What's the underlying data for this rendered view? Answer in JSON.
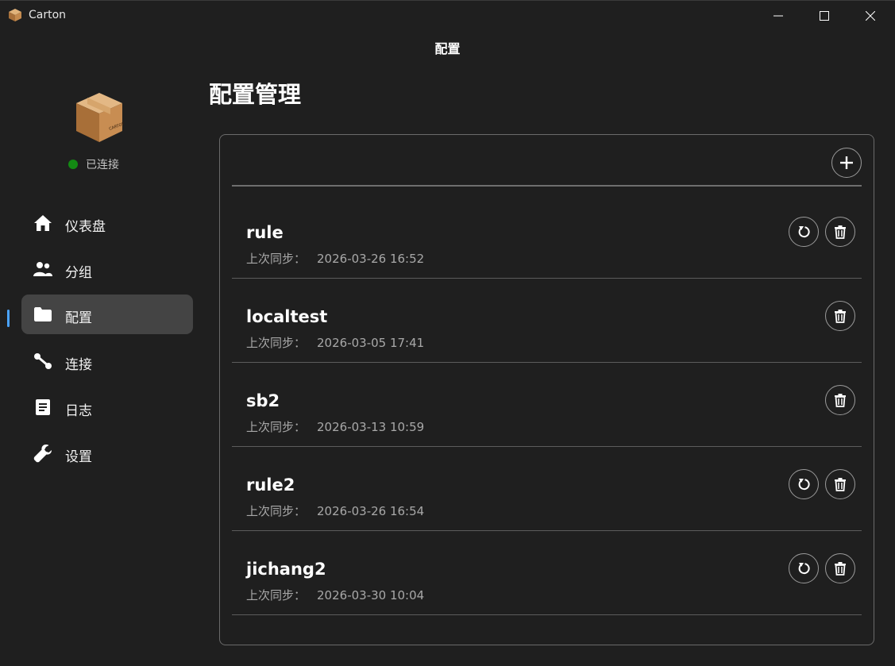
{
  "window": {
    "title": "Carton",
    "page_heading": "配置"
  },
  "sidebar": {
    "status": {
      "text": "已连接",
      "color": "#138a13"
    },
    "items": [
      {
        "label": "仪表盘",
        "icon": "home-icon"
      },
      {
        "label": "分组",
        "icon": "group-icon"
      },
      {
        "label": "配置",
        "icon": "folder-icon",
        "active": true
      },
      {
        "label": "连接",
        "icon": "connection-icon"
      },
      {
        "label": "日志",
        "icon": "document-icon"
      },
      {
        "label": "设置",
        "icon": "wrench-icon"
      }
    ]
  },
  "main": {
    "title": "配置管理",
    "add_icon": "plus-icon",
    "sync_label": "上次同步：",
    "profiles": [
      {
        "name": "rule",
        "last_sync": "2026-03-26 16:52",
        "refresh": true
      },
      {
        "name": "localtest",
        "last_sync": "2026-03-05 17:41",
        "refresh": false
      },
      {
        "name": "sb2",
        "last_sync": "2026-03-13 10:59",
        "refresh": false
      },
      {
        "name": "rule2",
        "last_sync": "2026-03-26 16:54",
        "refresh": true
      },
      {
        "name": "jichang2",
        "last_sync": "2026-03-30 10:04",
        "refresh": true
      }
    ]
  },
  "colors": {
    "background": "#1f1f1f",
    "active_nav": "#444444",
    "accent": "#4aa3ff"
  }
}
